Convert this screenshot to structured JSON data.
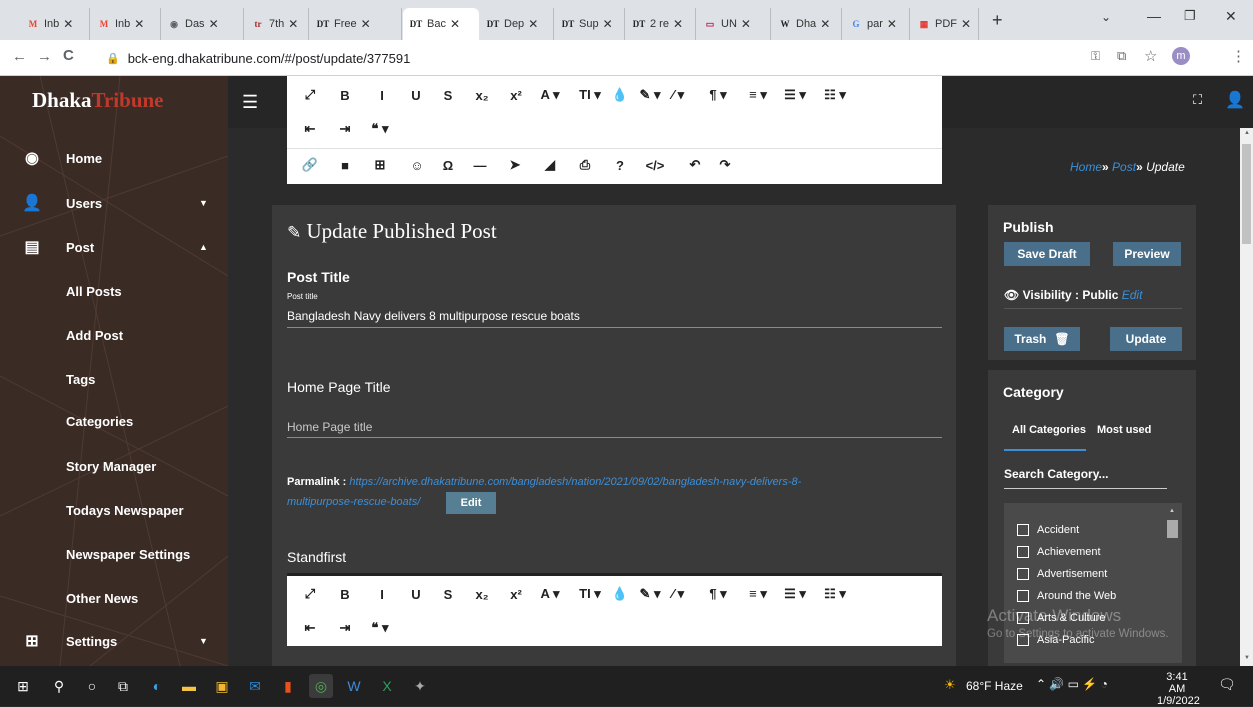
{
  "browser": {
    "tabs": [
      {
        "favicon": "M",
        "label": "Inb",
        "color": "#ea4335"
      },
      {
        "favicon": "M",
        "label": "Inb",
        "color": "#ea4335"
      },
      {
        "favicon": "◉",
        "label": "Das",
        "color": "#5f6368"
      },
      {
        "favicon": "tr",
        "label": "7th",
        "color": "#a82828"
      },
      {
        "favicon": "DT",
        "label": "Free",
        "color": "#222"
      },
      {
        "favicon": "DT",
        "label": "Bac",
        "color": "#222"
      },
      {
        "favicon": "DT",
        "label": "Dep",
        "color": "#222"
      },
      {
        "favicon": "DT",
        "label": "Sup",
        "color": "#222"
      },
      {
        "favicon": "DT",
        "label": "2 re",
        "color": "#222"
      },
      {
        "favicon": "▭",
        "label": "UN",
        "color": "#c2185b"
      },
      {
        "favicon": "W",
        "label": "Dha",
        "color": "#222"
      },
      {
        "favicon": "G",
        "label": "par",
        "color": "#4285f4"
      },
      {
        "favicon": "▦",
        "label": "PDF",
        "color": "#e53935"
      }
    ],
    "new_tab": "+",
    "url": "bck-eng.dhakatribune.com/#/post/update/377591",
    "profile_initial": "m"
  },
  "app": {
    "logo_part1": "Dhaka",
    "logo_part2": "Tribune"
  },
  "sidebar": {
    "items": [
      {
        "icon": "compass-icon",
        "label": "Home"
      },
      {
        "icon": "user-icon",
        "label": "Users"
      },
      {
        "icon": "card-icon",
        "label": "Post"
      },
      {
        "label": "All Posts"
      },
      {
        "label": "Add Post"
      },
      {
        "label": "Tags"
      },
      {
        "label": "Categories"
      },
      {
        "label": "Story Manager"
      },
      {
        "label": "Todays Newspaper"
      },
      {
        "label": "Newspaper Settings"
      },
      {
        "label": "Other News"
      },
      {
        "icon": "grid-icon",
        "label": "Settings"
      }
    ]
  },
  "breadcrumb": {
    "home": "Home",
    "post": "Post",
    "current": "Update",
    "sep": "»"
  },
  "editor": {
    "toolbar_row1": [
      "⤢",
      "B",
      "I",
      "U",
      "S",
      "x₂",
      "x²",
      "A ▾",
      "TI ▾",
      "💧",
      "✎ ▾",
      "⁄ ▾",
      "¶ ▾",
      "≡ ▾",
      "☰ ▾",
      "☷ ▾"
    ],
    "toolbar_row2": [
      "⇤",
      "⇥",
      "❝ ▾"
    ],
    "toolbar_row3": [
      "🔗",
      "■",
      "⊞",
      "☺",
      "Ω",
      "—",
      "➤",
      "◢",
      "⎙",
      "?",
      "</>",
      "↶",
      "↷"
    ]
  },
  "post": {
    "heading": "Update Published Post",
    "title_label": "Post Title",
    "title_sublabel": "Post title",
    "title_value": "Bangladesh Navy delivers 8 multipurpose rescue boats",
    "home_title_label": "Home Page Title",
    "home_title_placeholder": "Home Page title",
    "permalink_label": "Parmalink :",
    "permalink_url": "https://archive.dhakatribune.com/bangladesh/nation/2021/09/02/bangladesh-navy-delivers-8-",
    "permalink_url2": "multipurpose-rescue-boats/",
    "edit_button": "Edit",
    "standfirst_label": "Standfirst"
  },
  "publish": {
    "title": "Publish",
    "save_draft": "Save Draft",
    "preview": "Preview",
    "visibility_label": "Visibility : Public",
    "visibility_edit": "Edit",
    "trash": "Trash",
    "update": "Update"
  },
  "category": {
    "title": "Category",
    "tab_all": "All Categories",
    "tab_most_used": "Most used",
    "search_placeholder": "Search Category...",
    "items": [
      "Accident",
      "Achievement",
      "Advertisement",
      "Around the Web",
      "Arts & Culture",
      "Asia-Pacific"
    ]
  },
  "watermark": {
    "line1": "Activate Windows",
    "line2": "Go to Settings to activate Windows."
  },
  "taskbar": {
    "weather": "68°F Haze",
    "time": "3:41 AM",
    "date": "1/9/2022"
  }
}
